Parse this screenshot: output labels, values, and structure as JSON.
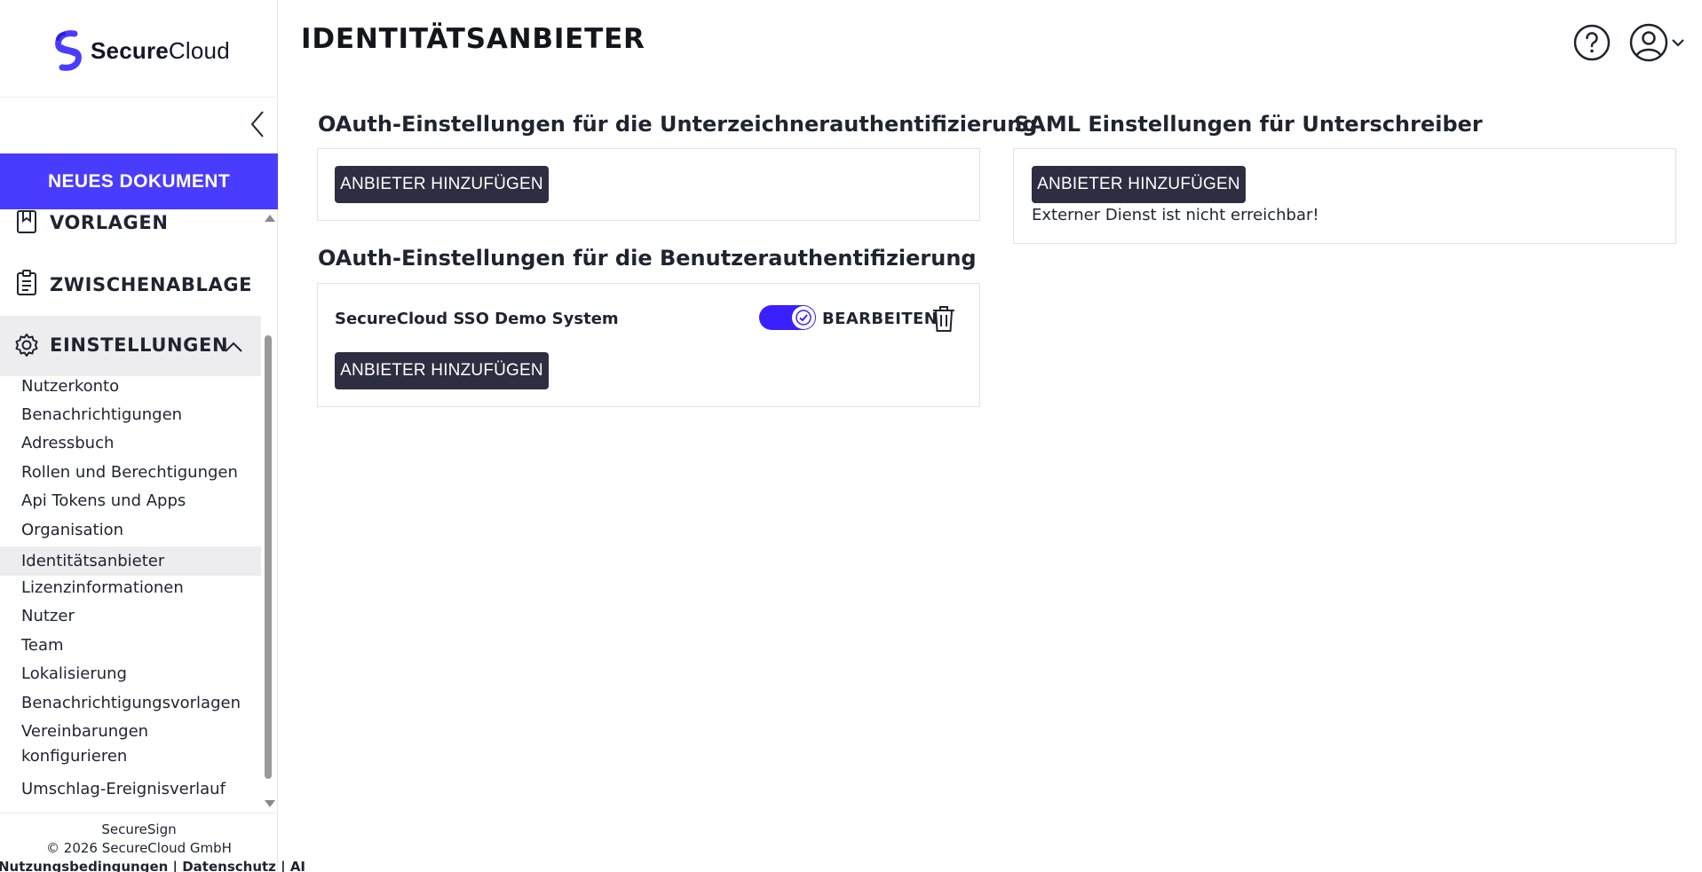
{
  "brand": {
    "name_bold": "Secure",
    "name_regular": "Cloud",
    "accent": "#4a3cff",
    "button_dark": "#2e2e42"
  },
  "sidebar": {
    "new_document": "NEUES DOKUMENT",
    "main_items": [
      {
        "label": "VORLAGEN",
        "icon": "bookmark-icon"
      },
      {
        "label": "ZWISCHENABLAGE",
        "icon": "clipboard-icon"
      },
      {
        "label": "EINSTELLUNGEN",
        "icon": "gear-icon",
        "expanded": true
      }
    ],
    "sub_items": [
      "Nutzerkonto",
      "Benachrichtigungen",
      "Adressbuch",
      "Rollen und Berechtigungen",
      "Api Tokens und Apps",
      "Organisation",
      "Identitätsanbieter",
      "Lizenzinformationen",
      "Nutzer",
      "Team",
      "Lokalisierung",
      "Benachrichtigungsvorlagen",
      "Vereinbarungen konfigurieren",
      "Umschlag-Ereignisverlauf"
    ],
    "active_sub_item": "Identitätsanbieter",
    "footer": {
      "product": "SecureSign",
      "copyright": "© 2026 SecureCloud GmbH",
      "links_text": "Nutzungsbedingungen | Datenschutz | AI"
    }
  },
  "header": {
    "title": "IDENTITÄTSANBIETER",
    "help_icon": "help-circle-icon",
    "user_icon": "user-circle-icon"
  },
  "oauth_signer": {
    "title": "OAuth-Einstellungen für die Unterzeichnerauthentifizierung",
    "add_button": "ANBIETER HINZUFÜGEN"
  },
  "oauth_user": {
    "title": "OAuth-Einstellungen für die Benutzerauthentifizierung",
    "providers": [
      {
        "name": "SecureCloud SSO Demo System",
        "enabled": true,
        "edit_label": "BEARBEITEN"
      }
    ],
    "add_button": "ANBIETER HINZUFÜGEN"
  },
  "saml": {
    "title": "SAML Einstellungen für Unterschreiber",
    "add_button": "ANBIETER HINZUFÜGEN",
    "error_text": "Externer Dienst ist nicht erreichbar!"
  }
}
